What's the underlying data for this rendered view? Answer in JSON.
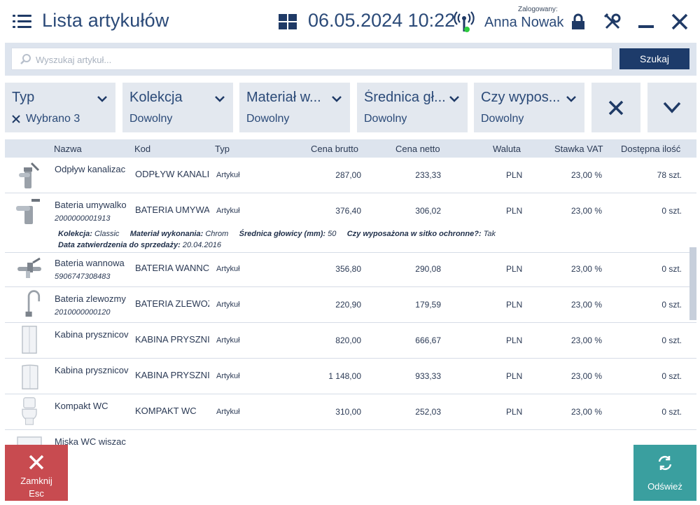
{
  "header": {
    "title": "Lista artykułów",
    "datetime": "06.05.2024 10:22",
    "logged_label": "Zalogowany:",
    "user": "Anna Nowak"
  },
  "search": {
    "placeholder": "Wyszukaj artykuł...",
    "button": "Szukaj"
  },
  "filters": [
    {
      "label": "Typ",
      "value": "Wybrano 3",
      "has_clear": true
    },
    {
      "label": "Kolekcja",
      "value": "Dowolny",
      "has_clear": false
    },
    {
      "label": "Materiał w...",
      "value": "Dowolny",
      "has_clear": false
    },
    {
      "label": "Średnica gł...",
      "value": "Dowolny",
      "has_clear": false
    },
    {
      "label": "Czy wypos...",
      "value": "Dowolny",
      "has_clear": false
    }
  ],
  "table": {
    "columns": [
      "Nazwa",
      "Kod",
      "Typ",
      "Cena brutto",
      "Cena netto",
      "Waluta",
      "Stawka VAT",
      "Dostępna ilość"
    ],
    "rows": [
      {
        "name": "Odpływ kanalizac",
        "ean": "",
        "code": "ODPŁYW KANALI",
        "type": "Artykuł",
        "brutto": "287,00",
        "netto": "233,33",
        "currency": "PLN",
        "vat": "23,00 %",
        "stock": "78 szt.",
        "icon": "bidet-faucet-icon"
      },
      {
        "name": "Bateria umywalko",
        "ean": "2000000001913",
        "code": "BATERIA UMYWA",
        "type": "Artykuł",
        "brutto": "376,40",
        "netto": "306,02",
        "currency": "PLN",
        "vat": "23,00 %",
        "stock": "0 szt.",
        "icon": "basin-faucet-icon"
      },
      {
        "name": "Bateria wannowa",
        "ean": "5906747308483",
        "code": "BATERIA WANNC",
        "type": "Artykuł",
        "brutto": "356,80",
        "netto": "290,08",
        "currency": "PLN",
        "vat": "23,00 %",
        "stock": "0 szt.",
        "icon": "bath-faucet-icon"
      },
      {
        "name": "Bateria zlewozmy",
        "ean": "2010000000120",
        "code": "BATERIA ZLEWOZ",
        "type": "Artykuł",
        "brutto": "220,90",
        "netto": "179,59",
        "currency": "PLN",
        "vat": "23,00 %",
        "stock": "0 szt.",
        "icon": "sink-faucet-icon"
      },
      {
        "name": "Kabina prysznicov",
        "ean": "",
        "code": "KABINA PRYSZNI",
        "type": "Artykuł",
        "brutto": "820,00",
        "netto": "666,67",
        "currency": "PLN",
        "vat": "23,00 %",
        "stock": "0 szt.",
        "icon": "shower-cabin-icon"
      },
      {
        "name": "Kabina prysznicov",
        "ean": "",
        "code": "KABINA PRYSZNI",
        "type": "Artykuł",
        "brutto": "1 148,00",
        "netto": "933,33",
        "currency": "PLN",
        "vat": "23,00 %",
        "stock": "0 szt.",
        "icon": "shower-cabin-round-icon"
      },
      {
        "name": "Kompakt WC",
        "ean": "",
        "code": "KOMPAKT WC",
        "type": "Artykuł",
        "brutto": "310,00",
        "netto": "252,03",
        "currency": "PLN",
        "vat": "23,00 %",
        "stock": "0 szt.",
        "icon": "toilet-icon"
      },
      {
        "name": "Miska WC wiszac",
        "ean": "",
        "code": "",
        "type": "",
        "brutto": "",
        "netto": "",
        "currency": "",
        "vat": "",
        "stock": "",
        "icon": "wall-toilet-icon"
      }
    ],
    "expanded_details": {
      "kolekcja_label": "Kolekcja:",
      "kolekcja_value": "Classic",
      "material_label": "Materiał wykonania:",
      "material_value": "Chrom",
      "srednica_label": "Średnica głowicy (mm):",
      "srednica_value": "50",
      "sitko_label": "Czy wyposażona w sitko ochronne?:",
      "sitko_value": "Tak",
      "data_label": "Data zatwierdzenia do sprzedaży:",
      "data_value": "20.04.2016"
    }
  },
  "footer": {
    "close_label": "Zamknij",
    "close_hint": "Esc",
    "refresh_label": "Odśwież"
  },
  "colors": {
    "brand_dark": "#1d3b6a",
    "close_red": "#c84b50",
    "refresh_teal": "#3a9f9f",
    "panel_grey": "#e3e8ef"
  }
}
